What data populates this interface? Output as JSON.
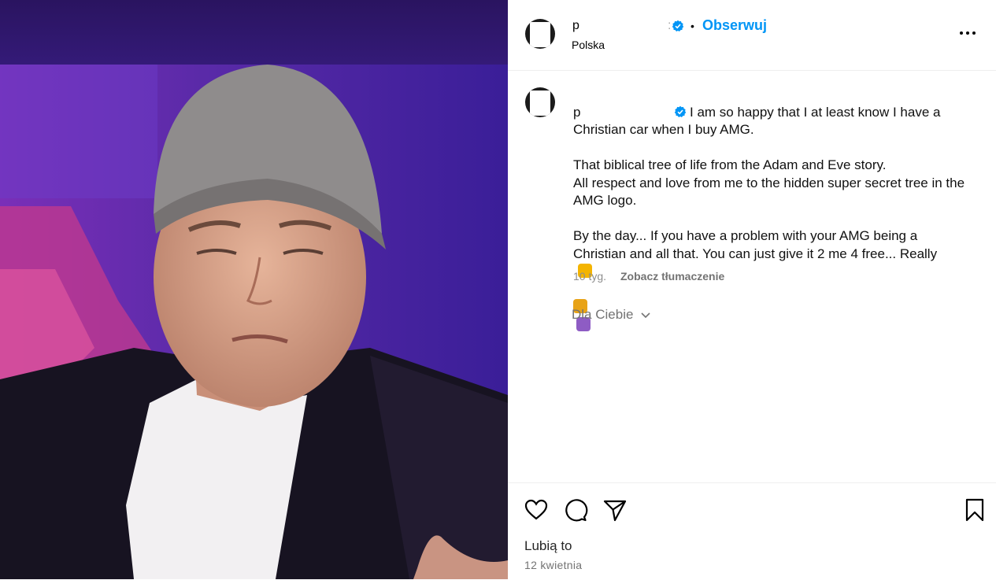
{
  "post": {
    "username": "p",
    "location": "Polska",
    "follow_label": "Obserwuj",
    "separator": "•",
    "verified_icon": "verified-badge-icon",
    "colors": {
      "accent": "#0095f6",
      "secondary_text": "#737373"
    }
  },
  "caption": {
    "username": "p",
    "text": "I am so happy that I at least know I have a Christian car when I buy AMG.\n\nThat biblical tree of life from the Adam and Eve story.\nAll respect and love from me to the hidden super secret tree in the AMG logo.\n\nBy the day... If you have a problem with your AMG being a Christian and all that. You can just give it 2 me 4 free... Really",
    "emojis": [
      "grinning-squinting-face-emoji",
      "medal-emoji",
      "latin-cross-emoji"
    ],
    "time_ago": "10 tyg.",
    "translate_label": "Zobacz tłumaczenie"
  },
  "for_you_label": "Dla Ciebie",
  "footer": {
    "likes_label": "Lubią to",
    "date": "12 kwietnia",
    "icons": [
      "heart-icon",
      "comment-icon",
      "share-icon",
      "bookmark-icon"
    ]
  }
}
